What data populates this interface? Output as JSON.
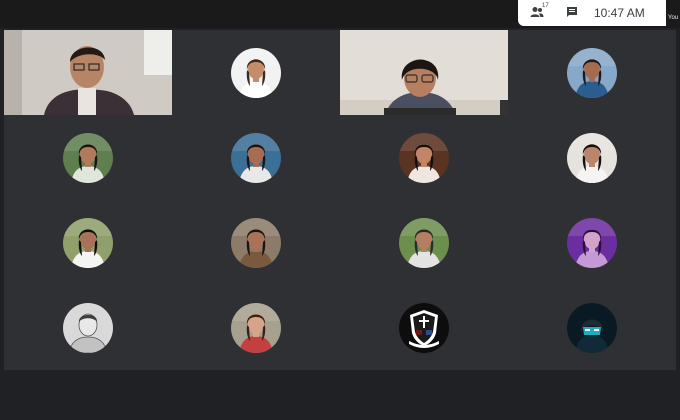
{
  "toolbar": {
    "participants_icon": "people-icon",
    "participant_count": "17",
    "chat_icon": "chat-icon",
    "time": "10:47 AM"
  },
  "self_label": "You",
  "tiles": [
    {
      "kind": "video",
      "scene": "man-glasses-office"
    },
    {
      "kind": "avatar",
      "scene": "white-cap-uniform",
      "bg": "#f2f2f2",
      "shirt": "#ffffff",
      "skin": "#c58c6a",
      "hair": "#3a2a20"
    },
    {
      "kind": "video",
      "scene": "woman-glasses-laptop"
    },
    {
      "kind": "avatar",
      "scene": "beach-sunset",
      "bg": "#87a9c9",
      "shirt": "#2b5d8e",
      "skin": "#a36b4f",
      "hair": "#1e1a18"
    },
    {
      "kind": "avatar",
      "scene": "striped-top-garden",
      "bg": "#5f7f4f",
      "shirt": "#dfe6dc",
      "skin": "#b07a5d",
      "hair": "#1a1410"
    },
    {
      "kind": "avatar",
      "scene": "blue-water",
      "bg": "#3c6f96",
      "shirt": "#e8e8e8",
      "skin": "#a76d54",
      "hair": "#1b1512"
    },
    {
      "kind": "avatar",
      "scene": "dark-orange",
      "bg": "#5a3322",
      "shirt": "#f0e6e0",
      "skin": "#c28566",
      "hair": "#140f0c"
    },
    {
      "kind": "avatar",
      "scene": "white-wall",
      "bg": "#e6e3df",
      "shirt": "#f6f4f2",
      "skin": "#b9866c",
      "hair": "#141010"
    },
    {
      "kind": "avatar",
      "scene": "colorful-mural",
      "bg": "#8fa06a",
      "shirt": "#f4f4f4",
      "skin": "#a8725a",
      "hair": "#120e0c"
    },
    {
      "kind": "avatar",
      "scene": "brown-uniform",
      "bg": "#8c7b68",
      "shirt": "#7a5a3e",
      "skin": "#a87358",
      "hair": "#1c1612"
    },
    {
      "kind": "avatar",
      "scene": "green-trees",
      "bg": "#6d8f4e",
      "shirt": "#e3e3e3",
      "skin": "#b47e62",
      "hair": "#2a2a2a"
    },
    {
      "kind": "avatar",
      "scene": "purple-neon",
      "bg": "#6b2ea0",
      "shirt": "#c49ad6",
      "skin": "#d1a3c9",
      "hair": "#2a1036"
    },
    {
      "kind": "avatar",
      "scene": "sketch-man",
      "bg": "#d9d9d9",
      "shirt": "#c2c2c2",
      "skin": "#bdbdbd",
      "hair": "#3d3d3d"
    },
    {
      "kind": "avatar",
      "scene": "red-jacket",
      "bg": "#a8a08e",
      "shirt": "#c43f3f",
      "skin": "#d6a48a",
      "hair": "#3b2018"
    },
    {
      "kind": "avatar",
      "scene": "school-crest",
      "bg": "#0d0d0d",
      "shirt": "#ffffff",
      "skin": "#ffffff",
      "hair": "#0d0d0d"
    },
    {
      "kind": "avatar",
      "scene": "cyan-mask",
      "bg": "#0a1a24",
      "shirt": "#122a38",
      "skin": "#26c6da",
      "hair": "#0d0d0d"
    }
  ]
}
